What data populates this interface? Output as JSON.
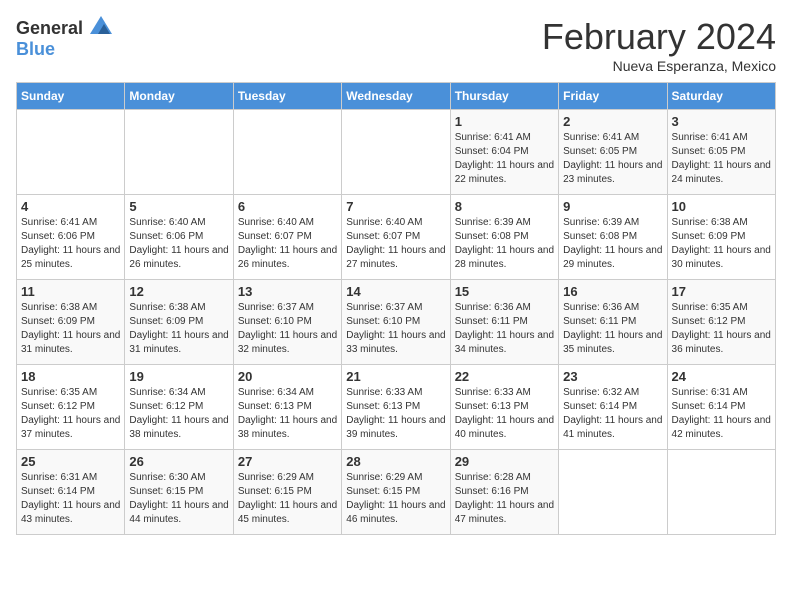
{
  "header": {
    "logo_general": "General",
    "logo_blue": "Blue",
    "month_year": "February 2024",
    "location": "Nueva Esperanza, Mexico"
  },
  "days_of_week": [
    "Sunday",
    "Monday",
    "Tuesday",
    "Wednesday",
    "Thursday",
    "Friday",
    "Saturday"
  ],
  "weeks": [
    [
      {
        "day": "",
        "info": ""
      },
      {
        "day": "",
        "info": ""
      },
      {
        "day": "",
        "info": ""
      },
      {
        "day": "",
        "info": ""
      },
      {
        "day": "1",
        "info": "Sunrise: 6:41 AM\nSunset: 6:04 PM\nDaylight: 11 hours and 22 minutes."
      },
      {
        "day": "2",
        "info": "Sunrise: 6:41 AM\nSunset: 6:05 PM\nDaylight: 11 hours and 23 minutes."
      },
      {
        "day": "3",
        "info": "Sunrise: 6:41 AM\nSunset: 6:05 PM\nDaylight: 11 hours and 24 minutes."
      }
    ],
    [
      {
        "day": "4",
        "info": "Sunrise: 6:41 AM\nSunset: 6:06 PM\nDaylight: 11 hours and 25 minutes."
      },
      {
        "day": "5",
        "info": "Sunrise: 6:40 AM\nSunset: 6:06 PM\nDaylight: 11 hours and 26 minutes."
      },
      {
        "day": "6",
        "info": "Sunrise: 6:40 AM\nSunset: 6:07 PM\nDaylight: 11 hours and 26 minutes."
      },
      {
        "day": "7",
        "info": "Sunrise: 6:40 AM\nSunset: 6:07 PM\nDaylight: 11 hours and 27 minutes."
      },
      {
        "day": "8",
        "info": "Sunrise: 6:39 AM\nSunset: 6:08 PM\nDaylight: 11 hours and 28 minutes."
      },
      {
        "day": "9",
        "info": "Sunrise: 6:39 AM\nSunset: 6:08 PM\nDaylight: 11 hours and 29 minutes."
      },
      {
        "day": "10",
        "info": "Sunrise: 6:38 AM\nSunset: 6:09 PM\nDaylight: 11 hours and 30 minutes."
      }
    ],
    [
      {
        "day": "11",
        "info": "Sunrise: 6:38 AM\nSunset: 6:09 PM\nDaylight: 11 hours and 31 minutes."
      },
      {
        "day": "12",
        "info": "Sunrise: 6:38 AM\nSunset: 6:09 PM\nDaylight: 11 hours and 31 minutes."
      },
      {
        "day": "13",
        "info": "Sunrise: 6:37 AM\nSunset: 6:10 PM\nDaylight: 11 hours and 32 minutes."
      },
      {
        "day": "14",
        "info": "Sunrise: 6:37 AM\nSunset: 6:10 PM\nDaylight: 11 hours and 33 minutes."
      },
      {
        "day": "15",
        "info": "Sunrise: 6:36 AM\nSunset: 6:11 PM\nDaylight: 11 hours and 34 minutes."
      },
      {
        "day": "16",
        "info": "Sunrise: 6:36 AM\nSunset: 6:11 PM\nDaylight: 11 hours and 35 minutes."
      },
      {
        "day": "17",
        "info": "Sunrise: 6:35 AM\nSunset: 6:12 PM\nDaylight: 11 hours and 36 minutes."
      }
    ],
    [
      {
        "day": "18",
        "info": "Sunrise: 6:35 AM\nSunset: 6:12 PM\nDaylight: 11 hours and 37 minutes."
      },
      {
        "day": "19",
        "info": "Sunrise: 6:34 AM\nSunset: 6:12 PM\nDaylight: 11 hours and 38 minutes."
      },
      {
        "day": "20",
        "info": "Sunrise: 6:34 AM\nSunset: 6:13 PM\nDaylight: 11 hours and 38 minutes."
      },
      {
        "day": "21",
        "info": "Sunrise: 6:33 AM\nSunset: 6:13 PM\nDaylight: 11 hours and 39 minutes."
      },
      {
        "day": "22",
        "info": "Sunrise: 6:33 AM\nSunset: 6:13 PM\nDaylight: 11 hours and 40 minutes."
      },
      {
        "day": "23",
        "info": "Sunrise: 6:32 AM\nSunset: 6:14 PM\nDaylight: 11 hours and 41 minutes."
      },
      {
        "day": "24",
        "info": "Sunrise: 6:31 AM\nSunset: 6:14 PM\nDaylight: 11 hours and 42 minutes."
      }
    ],
    [
      {
        "day": "25",
        "info": "Sunrise: 6:31 AM\nSunset: 6:14 PM\nDaylight: 11 hours and 43 minutes."
      },
      {
        "day": "26",
        "info": "Sunrise: 6:30 AM\nSunset: 6:15 PM\nDaylight: 11 hours and 44 minutes."
      },
      {
        "day": "27",
        "info": "Sunrise: 6:29 AM\nSunset: 6:15 PM\nDaylight: 11 hours and 45 minutes."
      },
      {
        "day": "28",
        "info": "Sunrise: 6:29 AM\nSunset: 6:15 PM\nDaylight: 11 hours and 46 minutes."
      },
      {
        "day": "29",
        "info": "Sunrise: 6:28 AM\nSunset: 6:16 PM\nDaylight: 11 hours and 47 minutes."
      },
      {
        "day": "",
        "info": ""
      },
      {
        "day": "",
        "info": ""
      }
    ]
  ]
}
